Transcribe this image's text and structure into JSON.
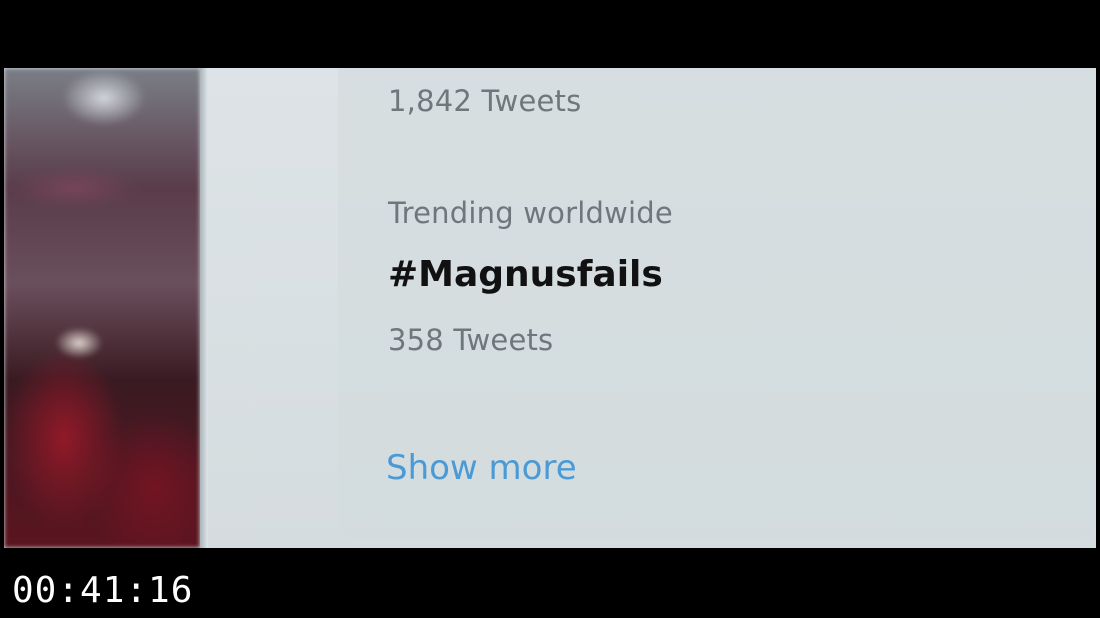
{
  "trends": {
    "previous_trend": {
      "tweet_count": "1,842 Tweets"
    },
    "current_trend": {
      "context": "Trending worldwide",
      "hashtag": "#Magnusfails",
      "tweet_count": "358 Tweets"
    },
    "show_more_label": "Show more"
  },
  "video": {
    "timestamp": "00:41:16"
  },
  "colors": {
    "link": "#4b9ad6",
    "muted_text": "#6f777c",
    "hashtag_text": "#111111",
    "screen_background": "#d9e0e3"
  }
}
